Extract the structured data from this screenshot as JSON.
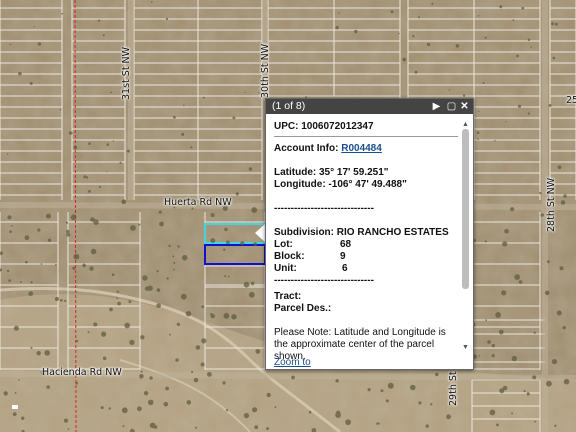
{
  "map": {
    "roads": {
      "huerta": "Huerta Rd NW",
      "hacienda": "Hacienda Rd NW",
      "st31": "31st St NW",
      "st30": "30th St NW",
      "st28": "28th St NW",
      "st29": "29th St",
      "edge_25": "25"
    },
    "colors": {
      "terrain": "#9c8866",
      "parcel_lines": "#e8e4dc",
      "highlight_cyan": "#3fd6e0",
      "highlight_blue": "#1010d0",
      "boundary_red": "#e02020"
    }
  },
  "popup": {
    "counter": "(1 of 8)",
    "next_icon": "play-icon",
    "maximize_icon": "maximize-icon",
    "close_icon": "close-icon",
    "upc": "UPC: 1006072012347",
    "account_label": "Account Info:",
    "account_link": "R004484",
    "latitude": "Latitude: 35° 17' 59.251\"",
    "longitude": "Longitude: -106° 47' 49.488\"",
    "separator": "------------------------------",
    "subdivision": "Subdivision: RIO RANCHO ESTATES",
    "lot_label": "Lot:",
    "lot_value": "68",
    "block_label": "Block:",
    "block_value": "9",
    "unit_label": "Unit:",
    "unit_value": "6",
    "tract": "Tract:",
    "parcel_des": "Parcel Des.:",
    "note": "Please Note: Latitude and Longitude is the approximate center of the parcel shown.",
    "zoom_link": "Zoom to"
  }
}
